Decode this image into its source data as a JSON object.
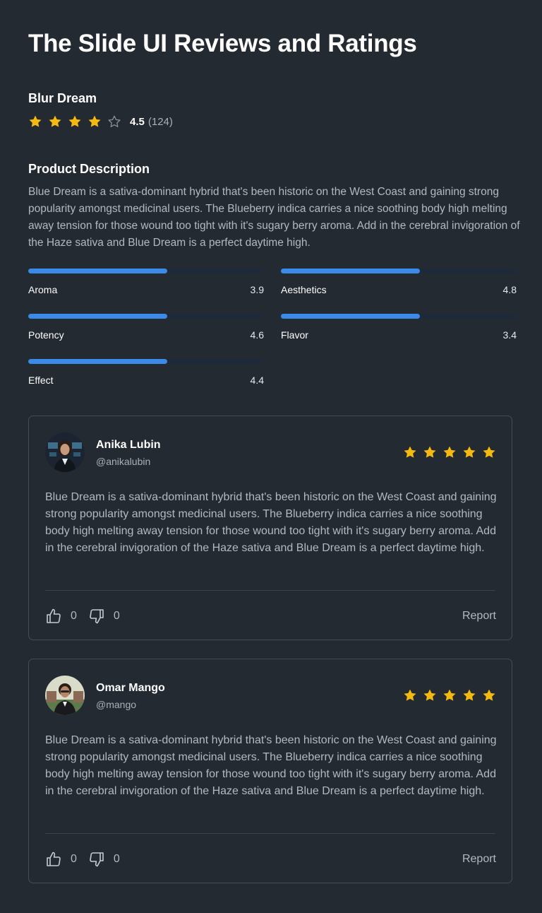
{
  "page": {
    "title": "The Slide UI Reviews and Ratings"
  },
  "product": {
    "name": "Blur Dream",
    "rating": "4.5",
    "rating_count": "(124)",
    "stars_filled": 4,
    "stars_total": 5
  },
  "description": {
    "title": "Product Description",
    "text": "Blue Dream is a sativa-dominant hybrid that's been historic on the West Coast and gaining strong popularity amongst medicinal users. The Blueberry indica carries a nice soothing body high melting away tension for those wound too tight with it's sugary berry aroma. Add in the cerebral invigoration of the Haze sativa and Blue Dream is a perfect daytime high."
  },
  "metrics": [
    {
      "label": "Aroma",
      "value": "3.9",
      "fill_fraction": 0.59
    },
    {
      "label": "Aesthetics",
      "value": "4.8",
      "fill_fraction": 0.59
    },
    {
      "label": "Potency",
      "value": "4.6",
      "fill_fraction": 0.59
    },
    {
      "label": "Flavor",
      "value": "3.4",
      "fill_fraction": 0.59
    },
    {
      "label": "Effect",
      "value": "4.4",
      "fill_fraction": 0.59
    }
  ],
  "reviews": [
    {
      "name": "Anika Lubin",
      "handle": "@anikalubin",
      "stars": 5,
      "text": "Blue Dream is a sativa-dominant hybrid that's been historic on the West Coast and gaining strong popularity amongst medicinal users. The Blueberry indica carries a nice soothing body high melting away tension for those wound too tight with it's sugary berry aroma. Add in the cerebral invigoration of the Haze sativa and Blue Dream is a perfect daytime high.",
      "likes": "0",
      "dislikes": "0",
      "report_label": "Report"
    },
    {
      "name": "Omar Mango",
      "handle": "@mango",
      "stars": 5,
      "text": "Blue Dream is a sativa-dominant hybrid that's been historic on the West Coast and gaining strong popularity amongst medicinal users. The Blueberry indica carries a nice soothing body high melting away tension for those wound too tight with it's sugary berry aroma. Add in the cerebral invigoration of the Haze sativa and Blue Dream is a perfect daytime high.",
      "likes": "0",
      "dislikes": "0",
      "report_label": "Report"
    }
  ],
  "icons": {
    "star_filled": "star-filled-icon",
    "star_empty": "star-outline-icon",
    "like": "thumbs-up-icon",
    "dislike": "thumbs-down-icon"
  },
  "colors": {
    "background": "#242a31",
    "star": "#f5b90f",
    "star_empty": "#8b9299",
    "accent": "#3b8ae8",
    "track": "#1e2a3a"
  }
}
